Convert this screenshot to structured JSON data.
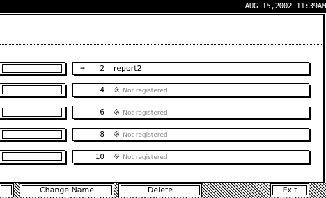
{
  "status_bar": {
    "datetime": "AUG  15,2002 11:39AM"
  },
  "rows": [
    {
      "number": "2",
      "name": "report2",
      "registered": true,
      "current": true
    },
    {
      "number": "4",
      "name": "Not registered",
      "registered": false,
      "current": false
    },
    {
      "number": "6",
      "name": "Not registered",
      "registered": false,
      "current": false
    },
    {
      "number": "8",
      "name": "Not registered",
      "registered": false,
      "current": false
    },
    {
      "number": "10",
      "name": "Not registered",
      "registered": false,
      "current": false
    }
  ],
  "unregistered_mark": "※",
  "current_marker": "➔",
  "buttons": {
    "change_name": "Change Name",
    "delete": "Delete",
    "exit": "Exit"
  }
}
